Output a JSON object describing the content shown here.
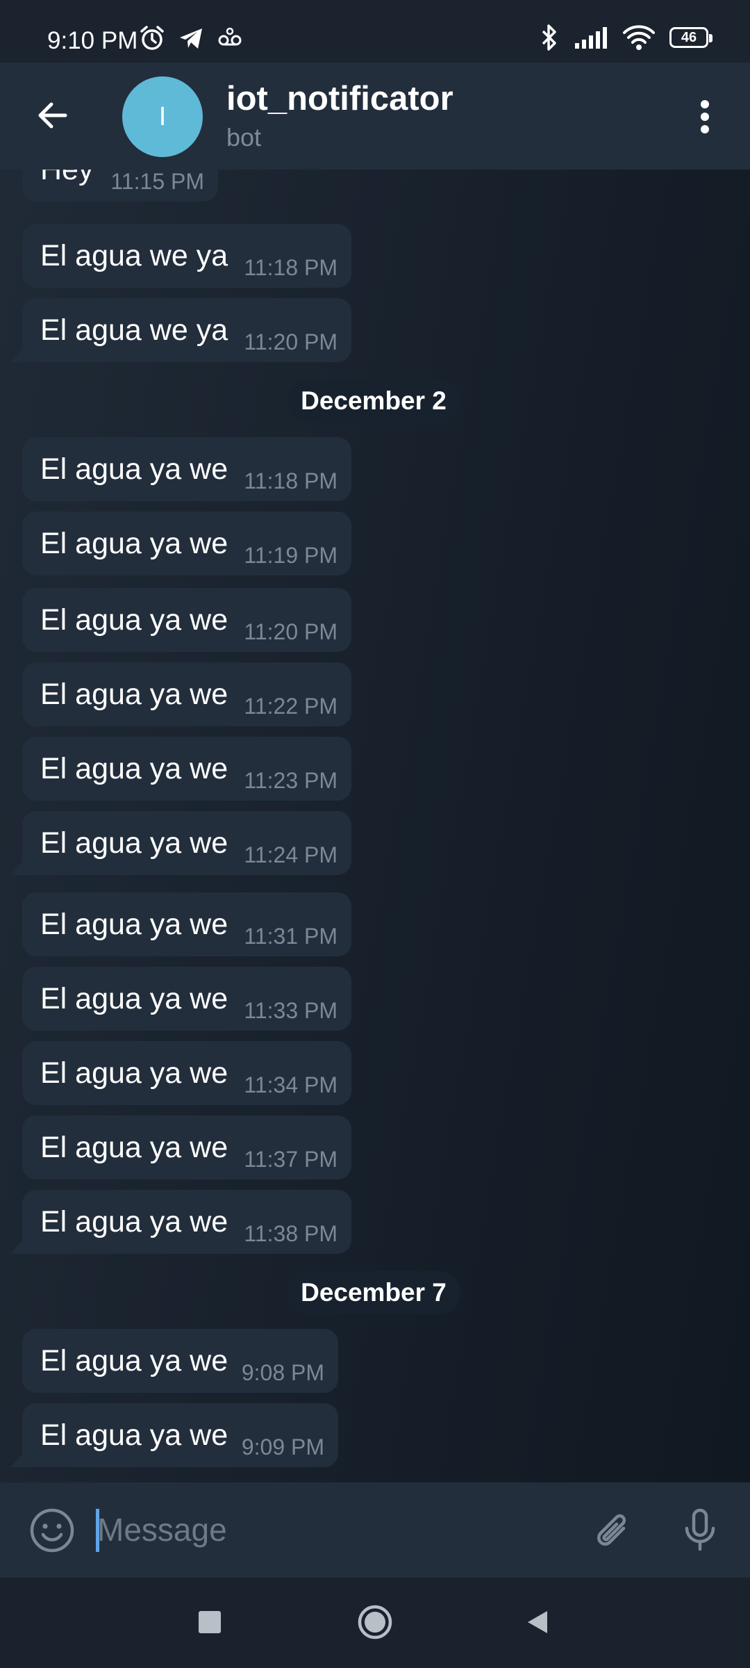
{
  "status_bar": {
    "time": "9:10 PM",
    "battery": "46",
    "left_icons": [
      "alarm-icon",
      "telegram-icon",
      "voicemail-icon"
    ],
    "right_icons": [
      "bluetooth-icon",
      "signal-icon",
      "wifi-icon",
      "battery-icon"
    ]
  },
  "header": {
    "avatar_letter": "I",
    "title": "iot_notificator",
    "subtitle": "bot",
    "avatar_color": "#5fbad7"
  },
  "messages": [
    {
      "type": "msg",
      "text": "Hey",
      "time": "11:15 PM"
    },
    {
      "type": "msg",
      "text": "El agua we ya",
      "time": "11:18 PM"
    },
    {
      "type": "msg",
      "text": "El agua we ya",
      "time": "11:20 PM"
    },
    {
      "type": "date",
      "text": "December 2"
    },
    {
      "type": "msg",
      "text": "El agua ya we",
      "time": "11:18 PM"
    },
    {
      "type": "msg",
      "text": "El agua ya we",
      "time": "11:19 PM"
    },
    {
      "type": "msg",
      "text": "El agua ya we",
      "time": "11:20 PM"
    },
    {
      "type": "msg",
      "text": "El agua ya we",
      "time": "11:22 PM"
    },
    {
      "type": "msg",
      "text": "El agua ya we",
      "time": "11:23 PM"
    },
    {
      "type": "msg",
      "text": "El agua ya we",
      "time": "11:24 PM"
    },
    {
      "type": "msg",
      "text": "El agua ya we",
      "time": "11:31 PM"
    },
    {
      "type": "msg",
      "text": "El agua ya we",
      "time": "11:33 PM"
    },
    {
      "type": "msg",
      "text": "El agua ya we",
      "time": "11:34 PM"
    },
    {
      "type": "msg",
      "text": "El agua ya we",
      "time": "11:37 PM"
    },
    {
      "type": "msg",
      "text": "El agua ya we",
      "time": "11:38 PM"
    },
    {
      "type": "date",
      "text": "December 7"
    },
    {
      "type": "msg",
      "text": "El agua ya we",
      "time": "9:08 PM"
    },
    {
      "type": "msg",
      "text": "El agua ya we",
      "time": "9:09 PM"
    }
  ],
  "input": {
    "placeholder": "Message"
  },
  "colors": {
    "bubble": "#232e3c",
    "accent": "#5ea5e8",
    "header": "#232e3c"
  }
}
